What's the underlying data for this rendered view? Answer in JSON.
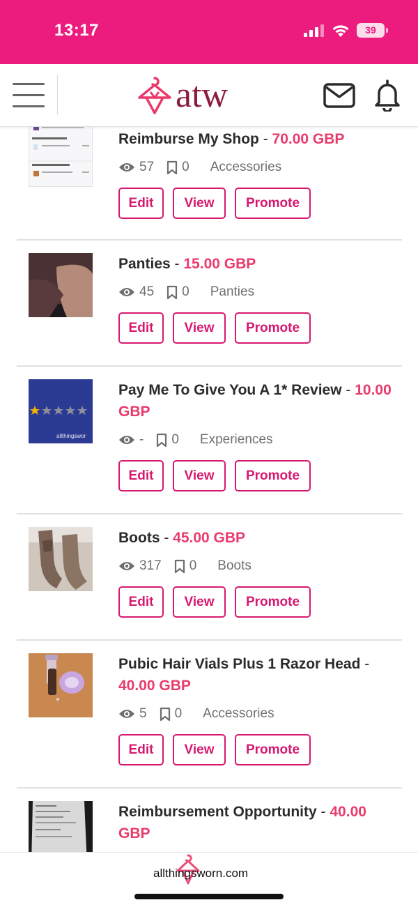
{
  "status_bar": {
    "time": "13:17",
    "battery": "39",
    "icons": [
      "signal-icon",
      "wifi-icon",
      "battery-icon"
    ]
  },
  "header": {
    "logo_text": "atw",
    "icons": [
      "menu-icon",
      "hanger-logo-icon",
      "mail-icon",
      "bell-icon"
    ]
  },
  "colors": {
    "brand_pink": "#ec1b7e",
    "price": "#ea3b6c",
    "logo_text": "#8b1c3c",
    "button_border": "#d6196f"
  },
  "buttons": {
    "edit": "Edit",
    "view": "View",
    "promote": "Promote"
  },
  "listings": [
    {
      "title": "Reimburse My Shop",
      "price": "70.00 GBP",
      "views": "57",
      "saves": "0",
      "category": "Accessories"
    },
    {
      "title": "Panties",
      "price": "15.00 GBP",
      "views": "45",
      "saves": "0",
      "category": "Panties"
    },
    {
      "title": "Pay Me To Give You A 1* Review",
      "price": "10.00 GBP",
      "views": "-",
      "saves": "0",
      "category": "Experiences",
      "thumb_text": "allthingswor"
    },
    {
      "title": "Boots",
      "price": "45.00 GBP",
      "views": "317",
      "saves": "0",
      "category": "Boots"
    },
    {
      "title": "Pubic Hair Vials Plus 1 Razor Head",
      "price": "40.00 GBP",
      "views": "5",
      "saves": "0",
      "category": "Accessories"
    },
    {
      "title": "Reimbursement Opportunity",
      "price": "40.00 GBP"
    }
  ],
  "footer": {
    "url_text": "allthingsworn.com"
  }
}
